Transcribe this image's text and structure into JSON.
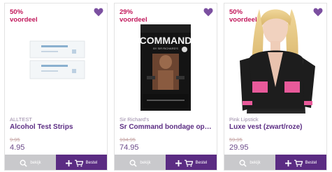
{
  "products": [
    {
      "discount": "50%\nvoordeel",
      "brand": "ALLTEST",
      "title": "Alcohol Test Strips",
      "old_price": "9.95",
      "price": "4.95",
      "view_label": "bekijk",
      "order_label": "Bestel",
      "image_text": "Alcohol Test Strip"
    },
    {
      "discount": "29%\nvoordeel",
      "brand": "Sir Richard's",
      "title": "Sr Command bondage ophanging",
      "old_price": "104.95",
      "price": "74.95",
      "view_label": "bekijk",
      "order_label": "Bestel",
      "image_text": "COMMAND",
      "image_subtext": "BY SIR RICHARD'S"
    },
    {
      "discount": "50%\nvoordeel",
      "brand": "Pink Lipstick",
      "title": "Luxe vest (zwart/roze)",
      "old_price": "59.95",
      "price": "29.95",
      "view_label": "bekijk",
      "order_label": "Bestel"
    }
  ],
  "colors": {
    "accent": "#5b2c83",
    "discount": "#c2185b",
    "view_button": "#c9c9cc"
  },
  "icons": {
    "favorite": "heart-icon",
    "view": "search-icon",
    "order": "cart-icon",
    "add": "plus-icon"
  }
}
